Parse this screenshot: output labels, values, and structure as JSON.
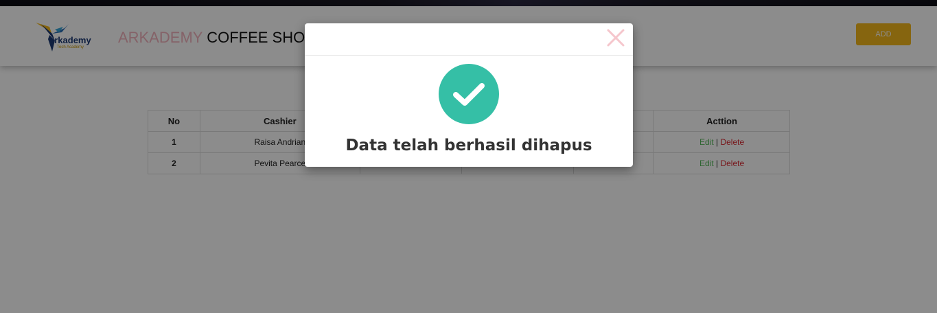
{
  "header": {
    "logo_text": "arkademy",
    "logo_subtext": "Tech Academy",
    "brand_highlight": "ARKADEMY",
    "brand_rest": "COFFEE SHO",
    "add_label": "ADD"
  },
  "table": {
    "columns": [
      "No",
      "Cashier",
      "",
      "",
      "",
      "Acttion"
    ],
    "rows": [
      {
        "no": "1",
        "cashier": "Raisa Andrian",
        "edit": "Edit",
        "sep": "|",
        "delete": "Delete"
      },
      {
        "no": "2",
        "cashier": "Pevita Pearce",
        "edit": "Edit",
        "sep": "|",
        "delete": "Delete"
      }
    ]
  },
  "modal": {
    "message": "Data telah berhasil dihapus",
    "icon": "check-icon",
    "close_icon": "close-icon"
  },
  "colors": {
    "accent_button": "#f5b91c",
    "brand_pink": "#f2b3bd",
    "success": "#35bfa6",
    "edit": "#57b85b",
    "delete": "#d9262e"
  }
}
